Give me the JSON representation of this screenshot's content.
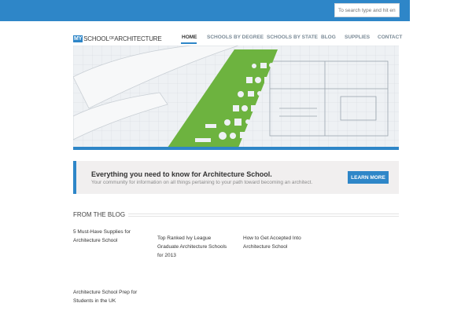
{
  "search": {
    "placeholder": "To search type and hit enter"
  },
  "logo": {
    "my": "MY",
    "school": "SCHOOL",
    "of": "OF",
    "architecture": "ARCHITECTURE"
  },
  "nav": {
    "items": [
      {
        "label": "Home",
        "active": true
      },
      {
        "label": "Schools by Degree"
      },
      {
        "label": "Schools by State"
      },
      {
        "label": "Blog"
      },
      {
        "label": "Supplies"
      },
      {
        "label": "Contact"
      }
    ]
  },
  "callout": {
    "title": "Everything you need to know for Architecture School.",
    "subtitle": "Your community for information on all things pertaining to your path toward becoming an architect.",
    "button": "Learn More"
  },
  "blog": {
    "heading": "From the Blog",
    "posts": [
      {
        "title_line1": "5 Must-Have Supplies for",
        "title_line2": "Architecture School"
      },
      {
        "title_line1": "Top Ranked Ivy League",
        "title_line2": "Graduate Architecture Schools",
        "title_line3": "for 2013"
      },
      {
        "title_line1": "How to Get Accepted Into",
        "title_line2": "Architecture School"
      },
      {
        "title_line1": "Architecture School Prep for",
        "title_line2": "Students in the UK"
      }
    ]
  },
  "colors": {
    "accent": "#2e86c8",
    "callout_bg": "#f1efef",
    "template_green": "#6db33f"
  }
}
